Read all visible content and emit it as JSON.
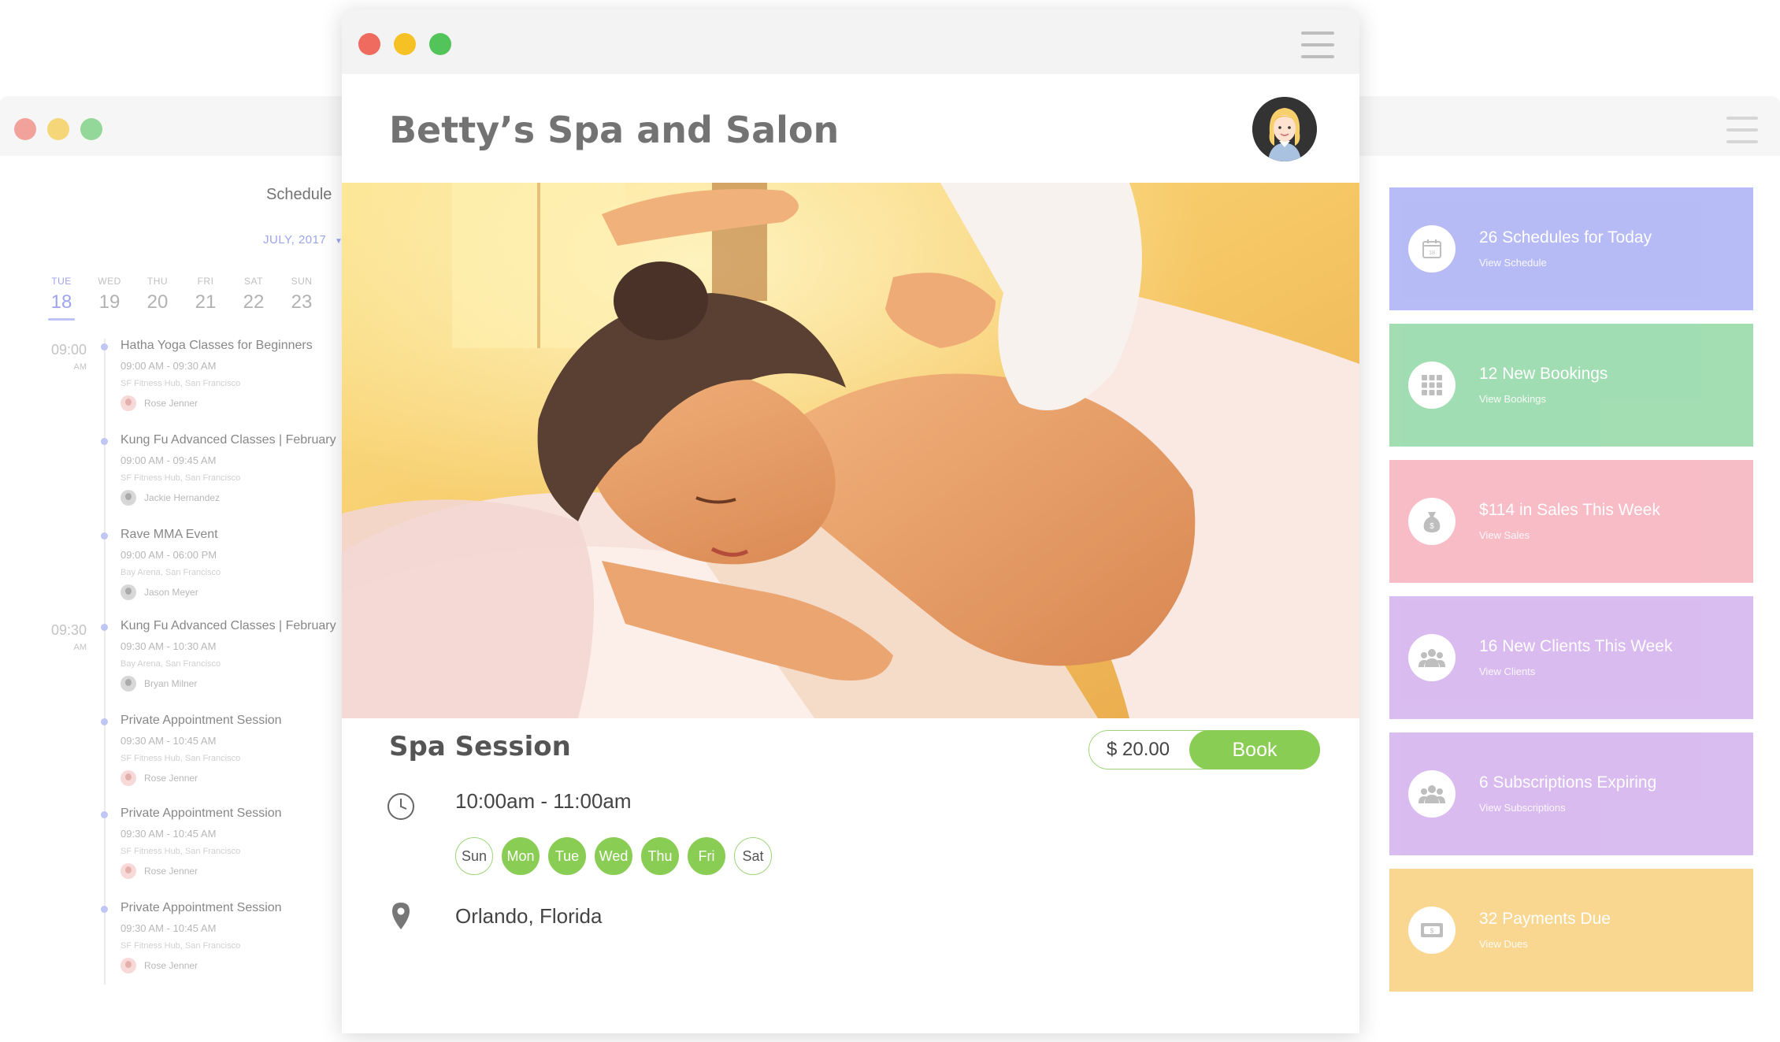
{
  "schedule": {
    "title": "Schedule",
    "month": "JULY, 2017",
    "days": [
      {
        "name": "TUE",
        "num": "18",
        "active": true
      },
      {
        "name": "WED",
        "num": "19"
      },
      {
        "name": "THU",
        "num": "20"
      },
      {
        "name": "FRI",
        "num": "21"
      },
      {
        "name": "SAT",
        "num": "22"
      },
      {
        "name": "SUN",
        "num": "23"
      }
    ],
    "time_slots": [
      {
        "time": "09:00",
        "ampm": "AM"
      },
      {
        "time": "09:30",
        "ampm": "AM"
      }
    ],
    "events": [
      {
        "title": "Hatha Yoga Classes for Beginners",
        "time": "09:00 AM - 09:30 AM",
        "location": "SF Fitness Hub, San Francisco",
        "person": "Rose Jenner"
      },
      {
        "title": "Kung Fu Advanced Classes | February",
        "time": "09:00 AM - 09:45 AM",
        "location": "SF Fitness Hub, San Francisco",
        "person": "Jackie Hernandez"
      },
      {
        "title": "Rave MMA Event",
        "time": "09:00 AM - 06:00 PM",
        "location": "Bay Arena, San Francisco",
        "person": "Jason Meyer"
      },
      {
        "title": "Kung Fu Advanced Classes | February",
        "time": "09:30 AM - 10:30 AM",
        "location": "Bay Arena, San Francisco",
        "person": "Bryan Milner"
      },
      {
        "title": "Private Appointment Session",
        "time": "09:30 AM - 10:45 AM",
        "location": "SF Fitness Hub, San Francisco",
        "person": "Rose Jenner"
      },
      {
        "title": "Private Appointment Session",
        "time": "09:30 AM - 10:45 AM",
        "location": "SF Fitness Hub, San Francisco",
        "person": "Rose Jenner"
      },
      {
        "title": "Private Appointment Session",
        "time": "09:30 AM - 10:45 AM",
        "location": "SF Fitness Hub, San Francisco",
        "person": "Rose Jenner"
      }
    ]
  },
  "main": {
    "brand": "Betty’s Spa and Salon",
    "service": "Spa Session",
    "price": "$ 20.00",
    "book_label": "Book",
    "hours": "10:00am - 11:00am",
    "weekdays": [
      {
        "label": "Sun",
        "on": false
      },
      {
        "label": "Mon",
        "on": true
      },
      {
        "label": "Tue",
        "on": true
      },
      {
        "label": "Wed",
        "on": true
      },
      {
        "label": "Thu",
        "on": true
      },
      {
        "label": "Fri",
        "on": true
      },
      {
        "label": "Sat",
        "on": false
      }
    ],
    "location": "Orlando, Florida"
  },
  "cards": [
    {
      "title": "26 Schedules for Today",
      "link": "View Schedule",
      "icon": "calendar-icon",
      "color": "#b4b8f5"
    },
    {
      "title": "12 New Bookings",
      "link": "View Bookings",
      "icon": "grid-icon",
      "color": "#9ddcae"
    },
    {
      "title": "$114 in Sales This Week",
      "link": "View Sales",
      "icon": "money-bag-icon",
      "color": "#f7b9c3"
    },
    {
      "title": "16 New Clients This Week",
      "link": "View Clients",
      "icon": "clients-icon",
      "color": "#d7b8ef"
    },
    {
      "title": "6 Subscriptions Expiring",
      "link": "View Subscriptions",
      "icon": "subscribers-icon",
      "color": "#d7b8ef"
    },
    {
      "title": "32 Payments Due",
      "link": "View Dues",
      "icon": "payment-icon",
      "color": "#f9d58b"
    }
  ],
  "colors": {
    "accent_green": "#8acd55",
    "accent_purple": "#7b87e6",
    "dot_red": "#ef6a5f",
    "dot_yellow": "#f5c125",
    "dot_green": "#52c45a"
  }
}
